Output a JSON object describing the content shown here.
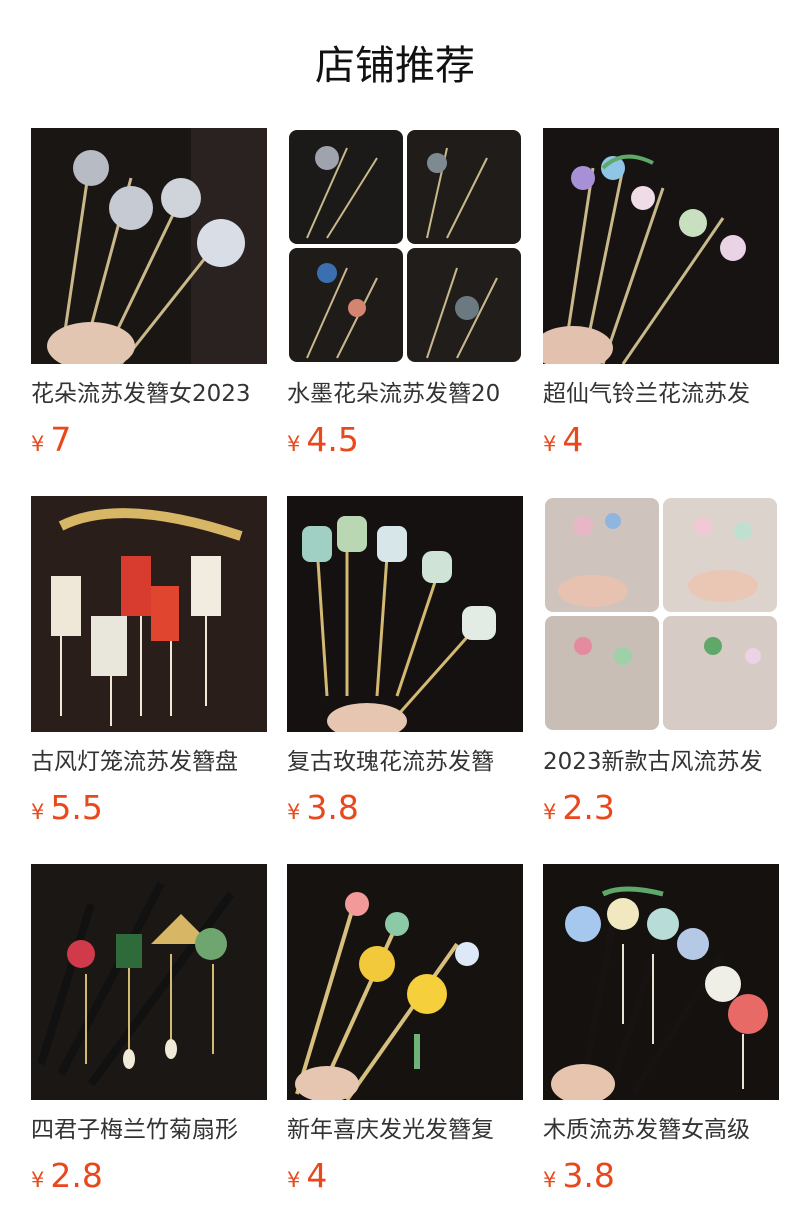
{
  "page": {
    "title": "店铺推荐"
  },
  "products": [
    {
      "name": "花朵流苏发簪女2023",
      "currency": "¥",
      "price": "7",
      "image_icon": "silver-flower-tassel-hairpins-photo"
    },
    {
      "name": "水墨花朵流苏发簪20",
      "currency": "¥",
      "price": "4.5",
      "image_icon": "ink-flower-hairpins-collage-photo"
    },
    {
      "name": "超仙气铃兰花流苏发",
      "currency": "¥",
      "price": "4",
      "image_icon": "lily-of-valley-hairpins-photo"
    },
    {
      "name": "古风灯笼流苏发簪盘",
      "currency": "¥",
      "price": "5.5",
      "image_icon": "lantern-tassel-hairpins-photo"
    },
    {
      "name": "复古玫瑰花流苏发簪",
      "currency": "¥",
      "price": "3.8",
      "image_icon": "vintage-rose-hairpins-photo"
    },
    {
      "name": "2023新款古风流苏发",
      "currency": "¥",
      "price": "2.3",
      "image_icon": "pink-flower-hairpins-collage-photo"
    },
    {
      "name": "四君子梅兰竹菊扇形",
      "currency": "¥",
      "price": "2.8",
      "image_icon": "four-gentlemen-fan-hairpins-photo"
    },
    {
      "name": "新年喜庆发光发簪复",
      "currency": "¥",
      "price": "4",
      "image_icon": "glowing-new-year-hairpins-photo"
    },
    {
      "name": "木质流苏发簪女高级",
      "currency": "¥",
      "price": "3.8",
      "image_icon": "wooden-flower-hairpins-photo"
    }
  ],
  "colors": {
    "price": "#e9481c",
    "name": "#333333",
    "title": "#111111"
  }
}
